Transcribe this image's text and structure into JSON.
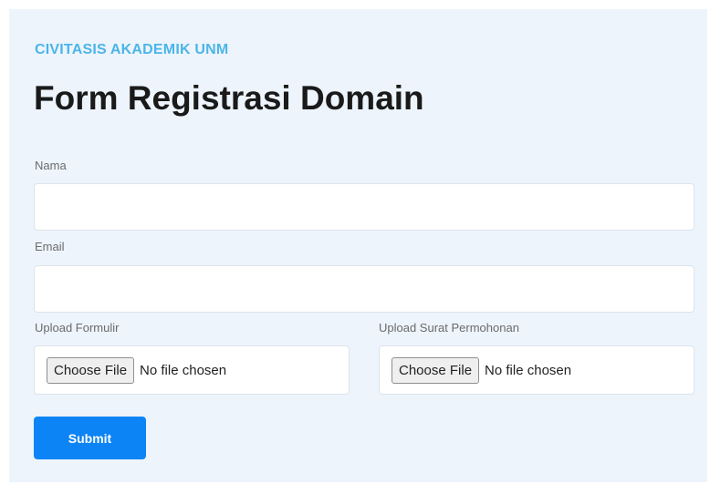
{
  "header": {
    "eyebrow": "CIVITASIS AKADEMIK UNM",
    "title": "Form Registrasi Domain"
  },
  "form": {
    "nama_label": "Nama",
    "nama_value": "",
    "email_label": "Email",
    "email_value": "",
    "upload_formulir_label": "Upload Formulir",
    "upload_surat_label": "Upload Surat Permohonan",
    "choose_file_label": "Choose File",
    "no_file_text": "No file chosen",
    "submit_label": "Submit"
  },
  "colors": {
    "background": "#edf4fc",
    "eyebrow": "#4cb5e8",
    "submit": "#0d84f5"
  }
}
